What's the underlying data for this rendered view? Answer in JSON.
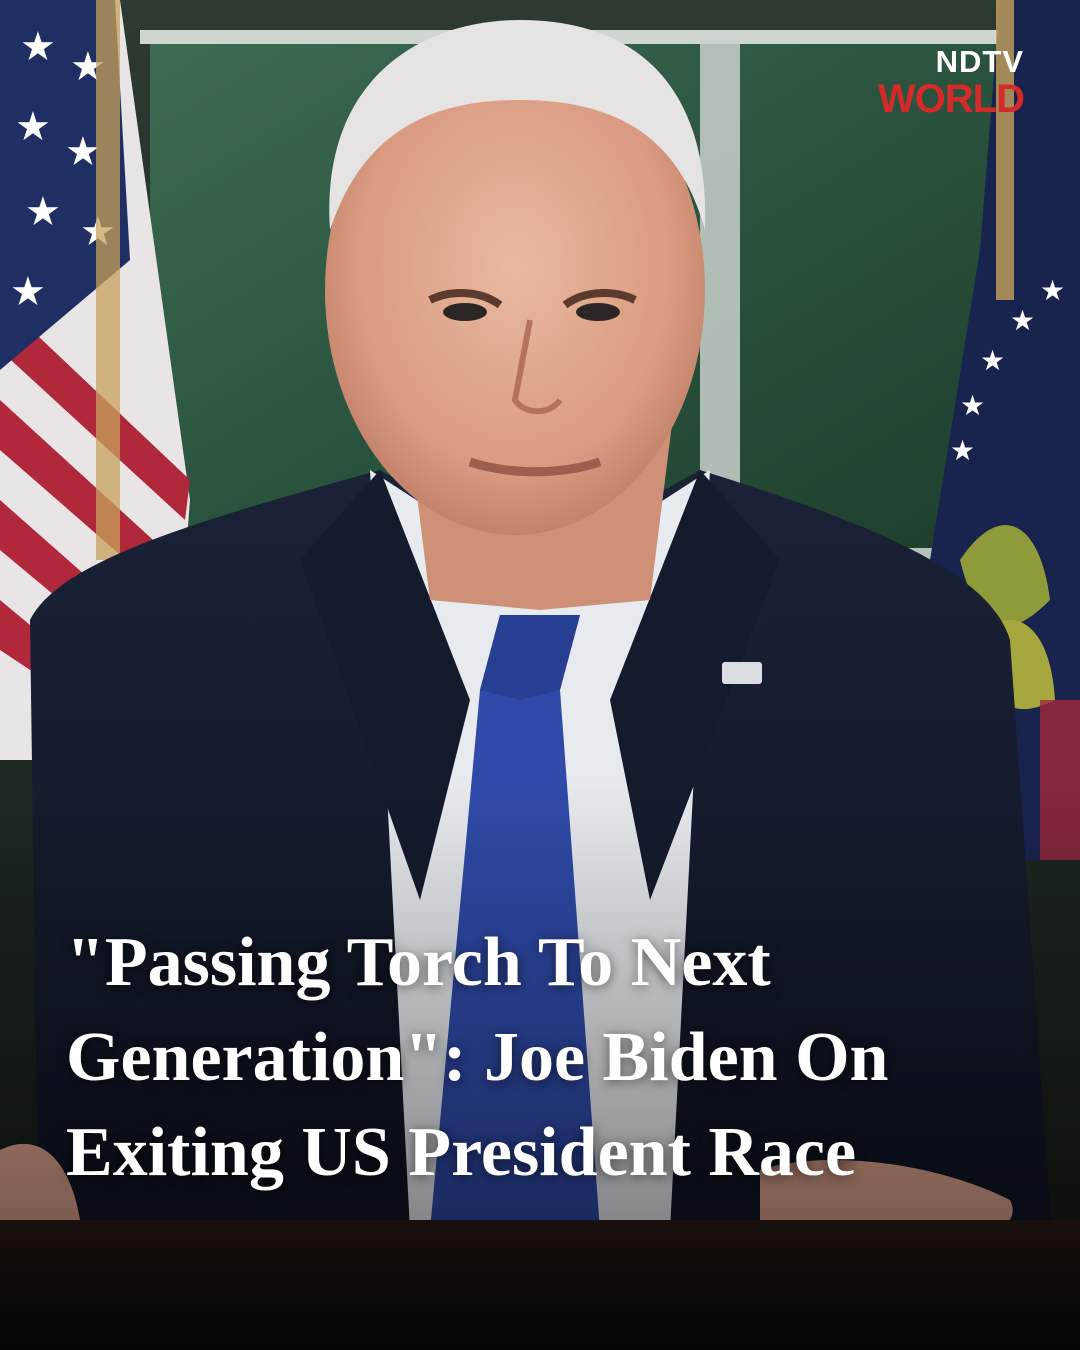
{
  "brand": {
    "top": "NDTV",
    "bottom": "WORLD",
    "accent_color": "#d62a2a"
  },
  "headline": {
    "lines": [
      "\"Passing Torch To Next",
      "Generation\": Joe Biden On",
      "Exiting US President Race"
    ]
  }
}
